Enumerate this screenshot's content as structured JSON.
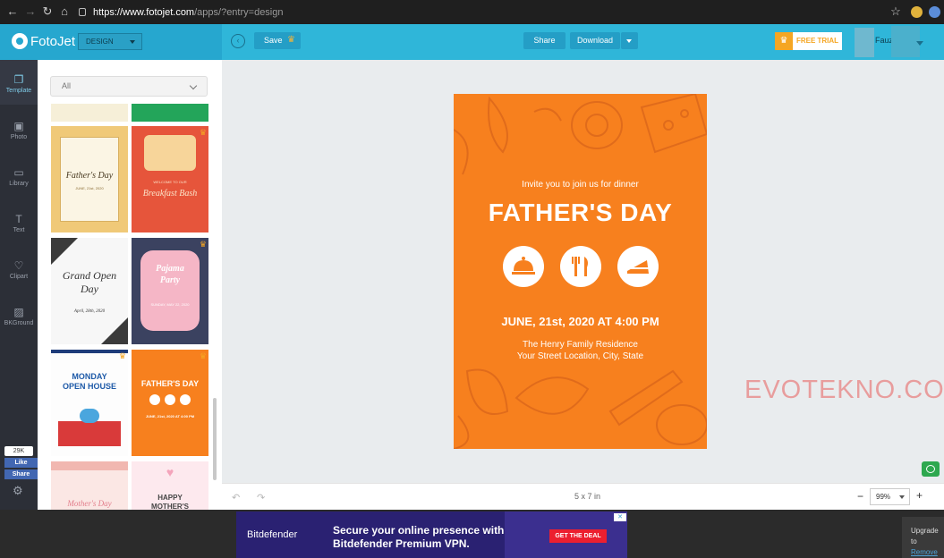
{
  "browser": {
    "url_host": "https://www.fotojet.com",
    "url_path": "/apps/?entry=design"
  },
  "app": {
    "logo": "FotoJet",
    "mode_select": "DESIGN",
    "save_label": "Save",
    "share_label": "Share",
    "download_label": "Download",
    "trial_label": "FREE TRIAL",
    "user_name": "Fauzi"
  },
  "rail": [
    {
      "label": "Template",
      "icon": "template-icon"
    },
    {
      "label": "Photo",
      "icon": "photo-icon"
    },
    {
      "label": "Library",
      "icon": "library-icon"
    },
    {
      "label": "Text",
      "icon": "text-icon"
    },
    {
      "label": "Clipart",
      "icon": "clipart-icon"
    },
    {
      "label": "BKGround",
      "icon": "background-icon"
    }
  ],
  "facebook": {
    "count": "29K",
    "like": "Like",
    "share": "Share"
  },
  "panel": {
    "category": "All",
    "templates": [
      {
        "title": "Father's Day",
        "sub": "JUNE, 21st, 2020"
      },
      {
        "title": "Breakfast Bash",
        "sub": "WELCOME TO OUR"
      },
      {
        "title": "Grand Open Day",
        "sub": "April, 28th, 2020"
      },
      {
        "title": "Pajama Party",
        "sub": "SUNDAY, MAY 22, 2020"
      },
      {
        "title": "MONDAY OPEN HOUSE",
        "sub": ""
      },
      {
        "title": "FATHER'S DAY",
        "sub": "JUNE, 21st, 2020 AT 4:00 PM"
      },
      {
        "title": "Mother's Day",
        "sub": ""
      },
      {
        "title": "HAPPY MOTHER'S DAY",
        "sub": ""
      }
    ]
  },
  "poster": {
    "invite": "Invite you to join us for dinner",
    "title": "FATHER'S DAY",
    "date": "JUNE, 21st, 2020 AT 4:00 PM",
    "venue": "The Henry Family Residence",
    "address": "Your Street Location, City, State",
    "bg_color": "#f7801e"
  },
  "watermark": "EVOTEKNO.COM",
  "toolbar": {
    "size": "5 x 7 in",
    "zoom": "99%"
  },
  "ad": {
    "brand": "Bitdefender",
    "headline_1": "Secure your online presence with",
    "headline_2": "Bitdefender Premium VPN.",
    "cta": "GET THE DEAL"
  },
  "upgrade": {
    "line1": "Upgrade to",
    "link": "Remove"
  }
}
